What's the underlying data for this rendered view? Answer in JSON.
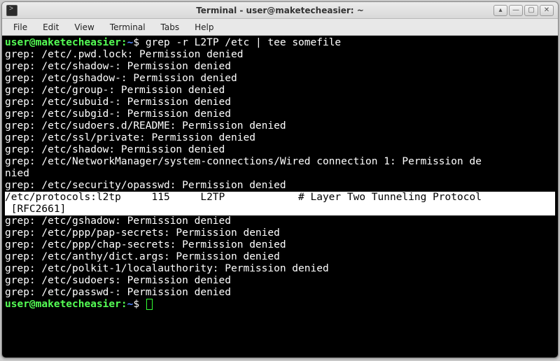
{
  "window": {
    "title": "Terminal - user@maketecheasier: ~"
  },
  "menubar": {
    "items": [
      "File",
      "Edit",
      "View",
      "Terminal",
      "Tabs",
      "Help"
    ]
  },
  "win_controls": {
    "up": "▴",
    "min": "—",
    "max": "▢",
    "close": "✕"
  },
  "prompt": {
    "user_host": "user@maketecheasier",
    "colon": ":",
    "cwd": "~",
    "sigil": "$"
  },
  "command": "grep -r L2TP /etc | tee somefile",
  "output_pre": [
    "grep: /etc/.pwd.lock: Permission denied",
    "grep: /etc/shadow-: Permission denied",
    "grep: /etc/gshadow-: Permission denied",
    "grep: /etc/group-: Permission denied",
    "grep: /etc/subuid-: Permission denied",
    "grep: /etc/subgid-: Permission denied",
    "grep: /etc/sudoers.d/README: Permission denied",
    "grep: /etc/ssl/private: Permission denied",
    "grep: /etc/shadow: Permission denied",
    "grep: /etc/NetworkManager/system-connections/Wired connection 1: Permission de",
    "nied",
    "grep: /etc/security/opasswd: Permission denied"
  ],
  "highlight_lines": [
    "/etc/protocols:l2tp     115     L2TP            # Layer Two Tunneling Protocol",
    " [RFC2661]"
  ],
  "output_post": [
    "grep: /etc/gshadow: Permission denied",
    "grep: /etc/ppp/pap-secrets: Permission denied",
    "grep: /etc/ppp/chap-secrets: Permission denied",
    "grep: /etc/anthy/dict.args: Permission denied",
    "grep: /etc/polkit-1/localauthority: Permission denied",
    "grep: /etc/sudoers: Permission denied",
    "grep: /etc/passwd-: Permission denied"
  ]
}
